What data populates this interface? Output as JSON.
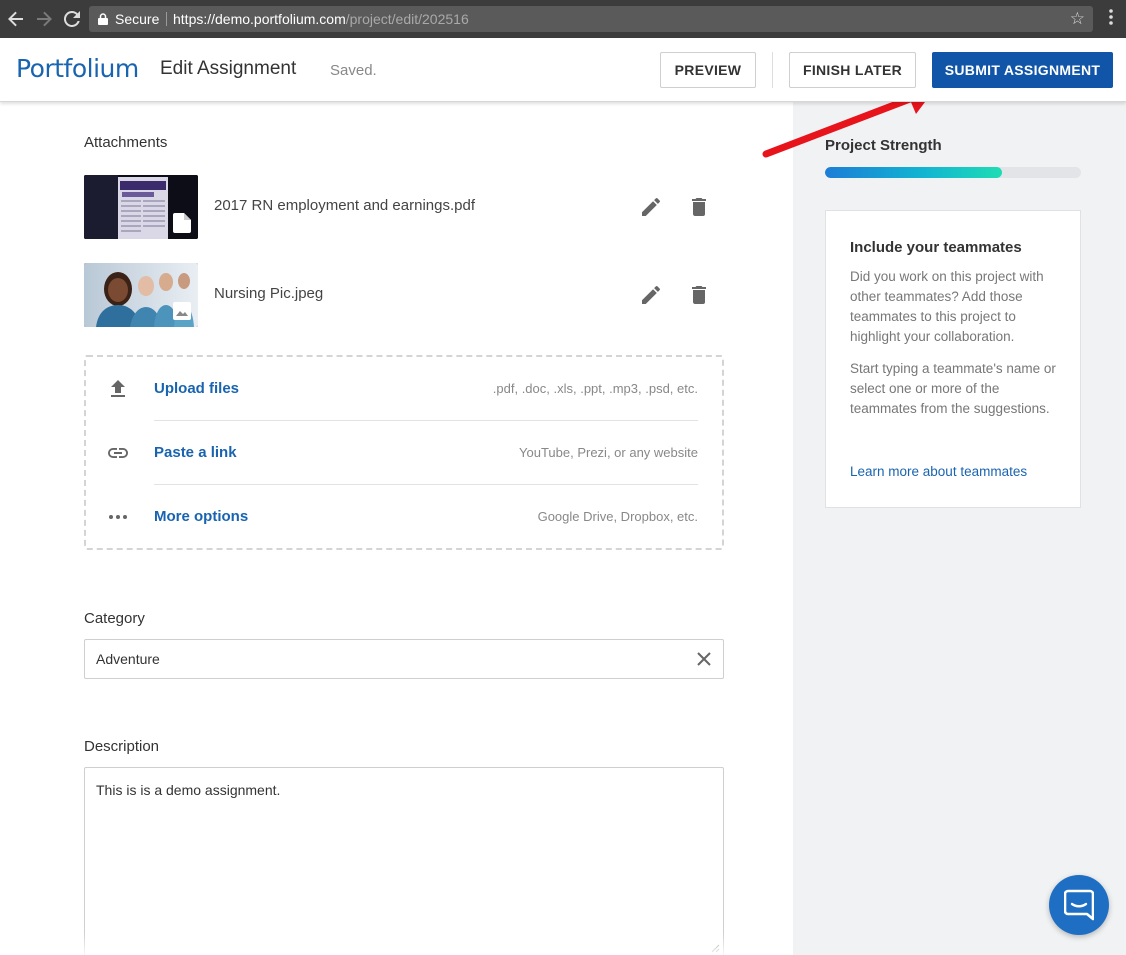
{
  "browser": {
    "secure_label": "Secure",
    "url_host": "https://demo.portfolium.com",
    "url_path": "/project/edit/202516",
    "icons": [
      "back-arrow-icon",
      "forward-arrow-icon",
      "reload-icon",
      "lock-icon",
      "star-icon",
      "kebab-menu-icon"
    ]
  },
  "header": {
    "logo": "Portfolium",
    "title": "Edit Assignment",
    "status": "Saved.",
    "preview_label": "PREVIEW",
    "finish_later_label": "FINISH LATER",
    "submit_label": "SUBMIT ASSIGNMENT",
    "submit_color": "#1155a8",
    "brand_color": "#1964b0"
  },
  "attachments": {
    "label": "Attachments",
    "items": [
      {
        "name": "2017 RN employment and earnings.pdf",
        "type_icon": "document-icon"
      },
      {
        "name": "Nursing Pic.jpeg",
        "type_icon": "image-icon"
      }
    ]
  },
  "upload_options": [
    {
      "label": "Upload files",
      "hint": ".pdf, .doc, .xls, .ppt, .mp3, .psd, etc.",
      "icon": "upload-icon"
    },
    {
      "label": "Paste a link",
      "hint": "YouTube, Prezi, or any website",
      "icon": "link-icon"
    },
    {
      "label": "More options",
      "hint": "Google Drive, Dropbox, etc.",
      "icon": "more-horizontal-icon"
    }
  ],
  "category": {
    "label": "Category",
    "value": "Adventure"
  },
  "description": {
    "label": "Description",
    "value": "This is is a demo assignment."
  },
  "sidebar": {
    "strength_label": "Project Strength",
    "strength_fraction": 0.69,
    "tip_title": "Include your teammates",
    "tip_p1": "Did you work on this project with other teammates? Add those teammates to this project to highlight your collaboration.",
    "tip_p2": "Start typing a teammate's name or select one or more of the teammates from the suggestions.",
    "tip_link": "Learn more about teammates"
  },
  "annotation": {
    "arrow_color": "#e8141b"
  }
}
